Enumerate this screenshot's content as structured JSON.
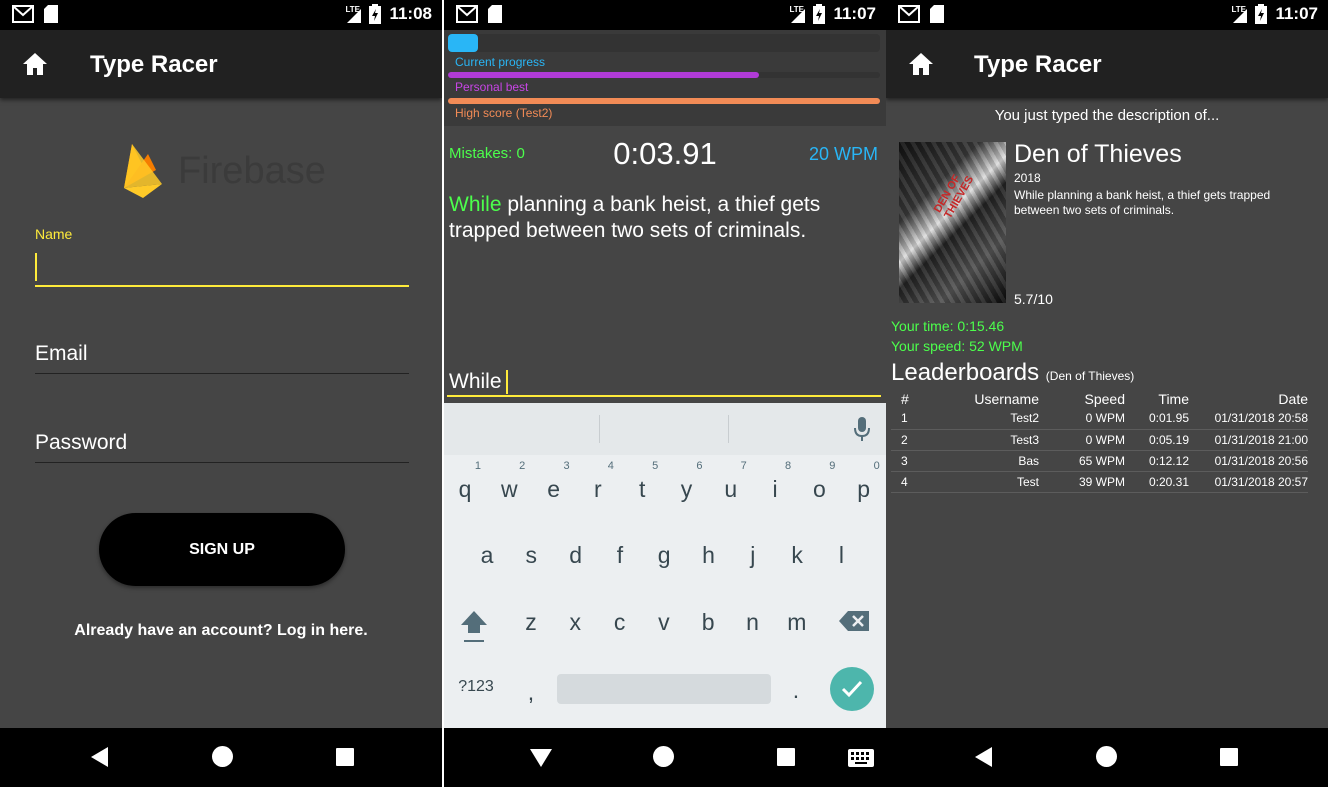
{
  "status": {
    "time_1": "11:08",
    "time_2": "11:07",
    "time_3": "11:07",
    "network": "LTE"
  },
  "app": {
    "title": "Type Racer"
  },
  "signup": {
    "logo_text": "Firebase",
    "name_label": "Name",
    "name_value": "",
    "email_placeholder": "Email",
    "password_placeholder": "Password",
    "signup_button": "SIGN UP",
    "login_link": "Already have an account? Log in here."
  },
  "race": {
    "progress_label": "Current progress",
    "progress_value": 0.07,
    "personal_best_label": "Personal best",
    "personal_best_value": 0.72,
    "high_score_label": "High score (Test2)",
    "high_score_value": 1.0,
    "mistakes": "Mistakes: 0",
    "timer": "0:03.91",
    "wpm": "20 WPM",
    "passage_typed": "While",
    "passage_rest": " planning a bank heist, a thief gets trapped between two sets of criminals.",
    "input_value": "While",
    "colors": {
      "progress": "#29b6f6",
      "personal_best": "#b03bd6",
      "high_score": "#f28b56"
    }
  },
  "keyboard": {
    "row1": [
      {
        "k": "q",
        "n": "1"
      },
      {
        "k": "w",
        "n": "2"
      },
      {
        "k": "e",
        "n": "3"
      },
      {
        "k": "r",
        "n": "4"
      },
      {
        "k": "t",
        "n": "5"
      },
      {
        "k": "y",
        "n": "6"
      },
      {
        "k": "u",
        "n": "7"
      },
      {
        "k": "i",
        "n": "8"
      },
      {
        "k": "o",
        "n": "9"
      },
      {
        "k": "p",
        "n": "0"
      }
    ],
    "row2": [
      "a",
      "s",
      "d",
      "f",
      "g",
      "h",
      "j",
      "k",
      "l"
    ],
    "row3": [
      "z",
      "x",
      "c",
      "v",
      "b",
      "n",
      "m"
    ],
    "symbols_key": "?123",
    "comma_key": ",",
    "period_key": "."
  },
  "result": {
    "intro": "You just typed the description of...",
    "poster_text": "DEN OF THIEVES",
    "movie_title": "Den of Thieves",
    "year": "2018",
    "description": "While planning a bank heist, a thief gets trapped between two sets of criminals.",
    "rating": "5.7/10",
    "your_time": "Your time: 0:15.46",
    "your_speed": "Your speed: 52 WPM",
    "leaderboard_title": "Leaderboards",
    "leaderboard_subtitle": "(Den of Thieves)",
    "columns": [
      "#",
      "Username",
      "Speed",
      "Time",
      "Date"
    ],
    "rows": [
      {
        "rank": "1",
        "user": "Test2",
        "speed": "0 WPM",
        "time": "0:01.95",
        "date": "01/31/2018 20:58"
      },
      {
        "rank": "2",
        "user": "Test3",
        "speed": "0 WPM",
        "time": "0:05.19",
        "date": "01/31/2018 21:00"
      },
      {
        "rank": "3",
        "user": "Bas",
        "speed": "65 WPM",
        "time": "0:12.12",
        "date": "01/31/2018 20:56"
      },
      {
        "rank": "4",
        "user": "Test",
        "speed": "39 WPM",
        "time": "0:20.31",
        "date": "01/31/2018 20:57"
      }
    ]
  }
}
